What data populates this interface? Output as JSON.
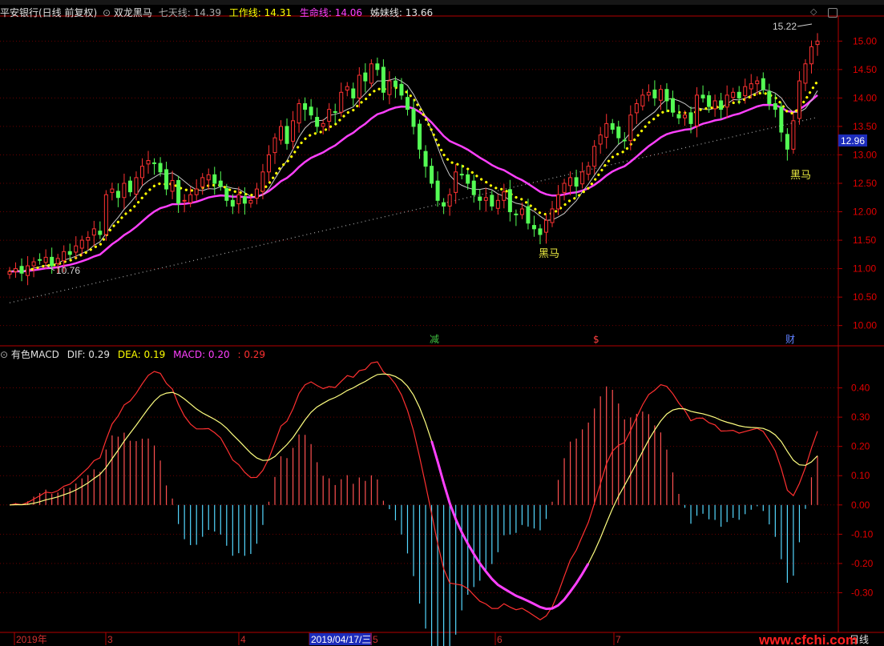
{
  "header": {
    "stock_name": "平安银行(日线 前复权)",
    "indicator_name": "双龙黑马",
    "seven_day_label": "七天线: 14.39",
    "work_line_label": "工作线: 14.31",
    "life_line_label": "生命线: 14.06",
    "sister_line_label": "姊妹线: 13.66"
  },
  "sub_header": {
    "name": "有色MACD",
    "dif_label": "DIF: 0.29",
    "dea_label": "DEA: 0.19",
    "macd_label": "MACD: 0.20",
    "extra_label": ": 0.29"
  },
  "annotations": {
    "high_price": "15.22",
    "low_price": "10.76",
    "current_price": "12.96",
    "heima_1": "黑马",
    "heima_2": "黑马",
    "event_jian": "减",
    "event_dollar": "$",
    "event_cai": "财"
  },
  "colors": {
    "up": "#ff3232",
    "down": "#54fc54",
    "life_line": "#ff40ff",
    "work_line": "#ffff00",
    "seven_day": "#c8c8c8",
    "sister_line": "#a0a0a0",
    "dif": "#ff3030",
    "dea": "#ffff80",
    "axis": "#b40000",
    "label": "#e0e000"
  },
  "footer": {
    "date_labels": [
      "2019年",
      "3",
      "4",
      "2019/04/17/三",
      "5",
      "6",
      "7"
    ],
    "period": "日线",
    "watermark": "www.cfchi.com"
  },
  "chart_data": [
    {
      "type": "candlestick",
      "title": "平安银行(日线 前复权)",
      "ylim": [
        9.7,
        15.3
      ],
      "yticks": [
        "15.00",
        "14.50",
        "14.00",
        "13.50",
        "13.00",
        "12.50",
        "12.00",
        "11.50",
        "11.00",
        "10.50",
        "10.00"
      ],
      "ytick_values": [
        15.0,
        14.5,
        14.0,
        13.5,
        13.0,
        12.5,
        12.0,
        11.5,
        11.0,
        10.5,
        10.0
      ],
      "close": [
        10.95,
        11.0,
        10.92,
        11.05,
        11.12,
        11.15,
        11.2,
        11.05,
        11.18,
        11.3,
        11.25,
        11.4,
        11.5,
        11.55,
        11.7,
        11.6,
        12.3,
        12.4,
        12.25,
        12.5,
        12.35,
        12.6,
        12.8,
        12.9,
        12.85,
        12.7,
        12.4,
        12.55,
        12.15,
        12.2,
        12.3,
        12.4,
        12.6,
        12.65,
        12.5,
        12.45,
        12.2,
        12.1,
        12.3,
        12.15,
        12.2,
        12.4,
        12.7,
        13.0,
        13.3,
        13.5,
        13.2,
        13.6,
        13.9,
        13.8,
        13.7,
        13.5,
        13.55,
        13.8,
        13.75,
        14.1,
        14.2,
        14.0,
        14.4,
        14.3,
        14.6,
        14.5,
        14.1,
        14.3,
        14.2,
        14.05,
        13.8,
        13.5,
        13.1,
        12.8,
        12.5,
        12.2,
        12.1,
        12.3,
        12.7,
        12.65,
        12.5,
        12.3,
        12.2,
        12.25,
        12.1,
        12.2,
        12.35,
        12.0,
        11.95,
        12.05,
        11.8,
        11.7,
        11.6,
        11.85,
        12.05,
        12.3,
        12.5,
        12.6,
        12.45,
        12.7,
        12.8,
        13.15,
        13.35,
        13.55,
        13.45,
        13.3,
        13.25,
        13.7,
        13.9,
        14.05,
        14.1,
        14.0,
        14.15,
        13.95,
        13.75,
        13.65,
        13.7,
        13.55,
        14.05,
        14.0,
        13.85,
        13.95,
        13.8,
        14.05,
        14.1,
        14.0,
        14.2,
        14.25,
        14.3,
        14.15,
        13.9,
        13.8,
        13.4,
        13.1,
        13.6,
        14.3,
        14.6,
        14.9,
        15.0
      ],
      "series": [
        {
          "name": "七天线"
        },
        {
          "name": "工作线"
        },
        {
          "name": "生命线"
        },
        {
          "name": "姊妹线"
        }
      ]
    },
    {
      "type": "line",
      "title": "有色MACD",
      "ylim": [
        -0.43,
        0.5
      ],
      "yticks": [
        "0.40",
        "0.30",
        "0.20",
        "0.10",
        "0.00",
        "-0.10",
        "-0.20",
        "-0.30"
      ],
      "ytick_values": [
        0.4,
        0.3,
        0.2,
        0.1,
        0.0,
        -0.1,
        -0.2,
        -0.3
      ],
      "series": [
        {
          "name": "DIF"
        },
        {
          "name": "DEA"
        },
        {
          "name": "MACD"
        }
      ]
    }
  ]
}
